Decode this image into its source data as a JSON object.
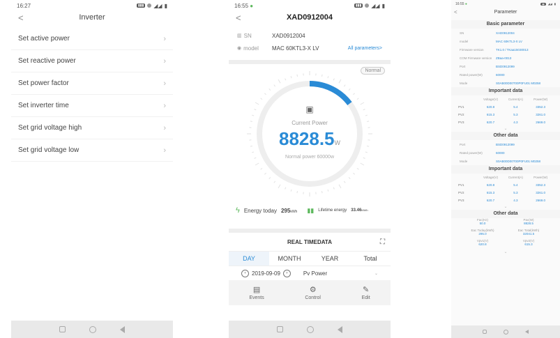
{
  "phone1": {
    "time": "16:27",
    "title": "Inverter",
    "menu": [
      "Set active power",
      "Set reactive power",
      "Set power factor",
      "Set inverter time",
      "Set grid voltage high",
      "Set grid voltage low"
    ]
  },
  "phone2": {
    "time": "16:55",
    "title": "XAD0912004",
    "sn_label": "SN",
    "sn": "XAD0912004",
    "model_label": "model",
    "model": "MAC 60KTL3-X LV",
    "all_params": "All parameters>",
    "status": "Normal",
    "current_power_label": "Current Power",
    "current_power": "8828.5",
    "power_unit": "W",
    "normal_power": "Normal power 60000w",
    "gauge_fraction": 0.147,
    "energy_today_label": "Energy today",
    "energy_today": "295",
    "energy_today_unit": "kWh",
    "lifetime_label": "Lifetime energy",
    "lifetime": "33.46",
    "lifetime_unit": "MWh",
    "realtime_title": "REAL TIMEDATA",
    "tabs": [
      "DAY",
      "MONTH",
      "YEAR",
      "Total"
    ],
    "date": "2019-09-09",
    "metric": "Pv Power",
    "actions": [
      "Events",
      "Control",
      "Edit"
    ]
  },
  "phone3": {
    "time": "16:55",
    "title": "Parameter",
    "basic_title": "Basic parameter",
    "basic": [
      {
        "label": "SN",
        "value": "XAD0912004"
      },
      {
        "label": "model",
        "value": "MAC 60KTL3-X LV"
      },
      {
        "label": "Firmware version",
        "value": "TK1.0 / TKaa15030013"
      },
      {
        "label": "COM Firmware version",
        "value": "ZBaa-0013"
      },
      {
        "label": "Port",
        "value": "BSD0912099"
      },
      {
        "label": "Rated power(W)",
        "value": "60000"
      },
      {
        "label": "Mode",
        "value": "S0AB00D00T00P0FU01 M0258"
      }
    ],
    "important_title": "Important data",
    "table_headers": [
      "",
      "Voltage(V)",
      "Current(A)",
      "Power(W)"
    ],
    "table_rows": [
      [
        "PV1",
        "620.8",
        "5.4",
        "3352.3"
      ],
      [
        "PV2",
        "615.3",
        "5.3",
        "3261.0"
      ],
      [
        "PV3",
        "620.7",
        "4.3",
        "2669.0"
      ]
    ],
    "other_title": "Other data",
    "other": [
      {
        "label": "Port",
        "value": "BSD0912099"
      },
      {
        "label": "Rated power(W)",
        "value": "60000"
      },
      {
        "label": "Mode",
        "value": "S0AB00D00T00P0FU01 M0258"
      }
    ],
    "other2_title": "Other data",
    "grid": [
      {
        "label": "Fac(Hz)",
        "value": "50.0"
      },
      {
        "label": "Pac(W)",
        "value": "8828.5"
      },
      {
        "label": "Eac Today(kWh)",
        "value": "295.0"
      },
      {
        "label": "Eac Total(kWh)",
        "value": "32041.5"
      },
      {
        "label": "Vpv1(V)",
        "value": "620.8"
      },
      {
        "label": "Vpv2(V)",
        "value": "615.3"
      }
    ]
  },
  "colors": {
    "accent": "#2a8bd6",
    "gauge_track": "#eeeeee"
  }
}
